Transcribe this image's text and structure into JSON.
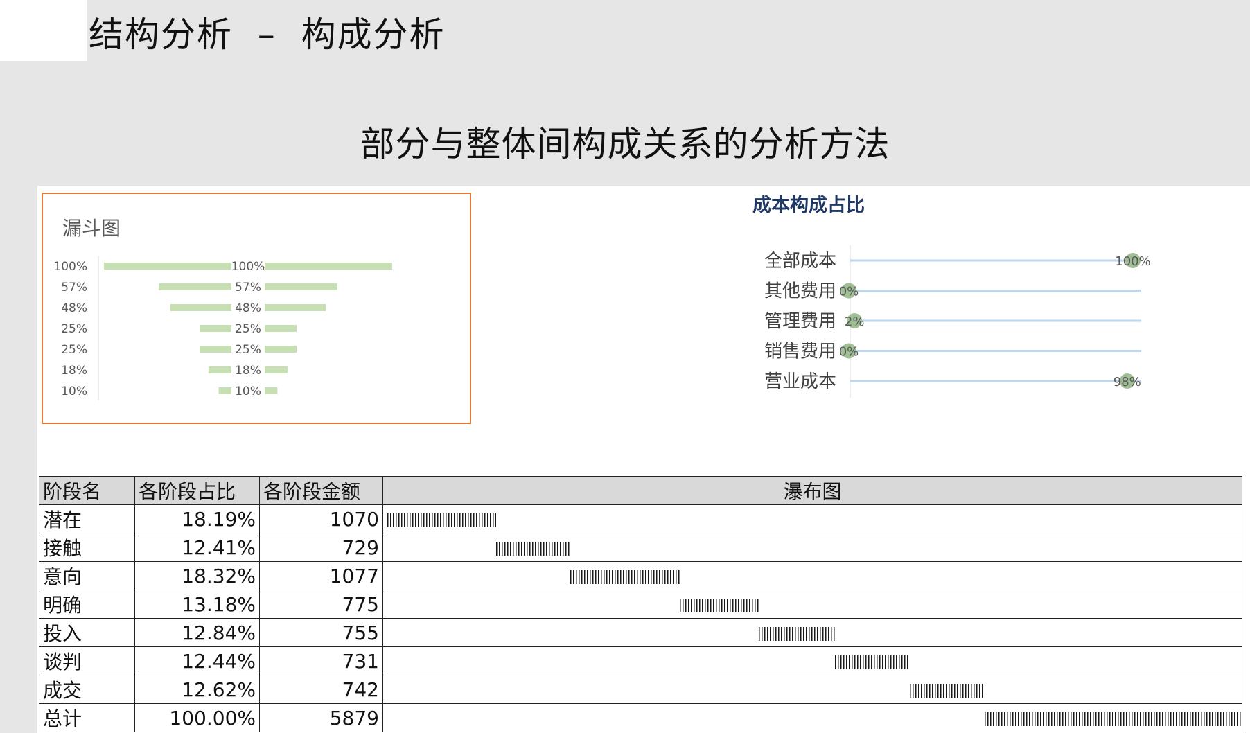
{
  "header": {
    "slide_title": "结构分析  –  构成分析",
    "subtitle": "部分与整体间构成关系的分析方法"
  },
  "colors": {
    "funnel_bar": "#c6e0b4",
    "card_border": "#e07b39",
    "lollipop_line": "#bdd7ee",
    "lollipop_dot": "#8fb381",
    "cost_title": "#1f3864"
  },
  "chart_data": [
    {
      "type": "bar",
      "subtype": "funnel",
      "title": "漏斗图",
      "categories": [
        "100%",
        "57%",
        "48%",
        "25%",
        "25%",
        "18%",
        "10%"
      ],
      "values": [
        100,
        57,
        48,
        25,
        25,
        18,
        10
      ],
      "data_labels": [
        "100%",
        "57%",
        "48%",
        "25%",
        "25%",
        "18%",
        "10%"
      ],
      "xlim": [
        0,
        100
      ],
      "grid": false
    },
    {
      "type": "scatter",
      "subtype": "lollipop",
      "title": "成本构成占比",
      "categories": [
        "全部成本",
        "其他费用",
        "管理费用",
        "销售费用",
        "营业成本"
      ],
      "values": [
        100,
        0,
        2,
        0,
        98
      ],
      "data_labels": [
        "100%",
        "0%",
        "2%",
        "0%",
        "98%"
      ],
      "xlim": [
        0,
        100
      ],
      "grid": false
    },
    {
      "type": "table",
      "subtype": "waterfall",
      "columns": [
        "阶段名",
        "各阶段占比",
        "各阶段金额",
        "瀑布图"
      ],
      "rows": [
        {
          "stage": "潜在",
          "share": "18.19%",
          "amount": "1070",
          "value": 1070
        },
        {
          "stage": "接触",
          "share": "12.41%",
          "amount": "729",
          "value": 729
        },
        {
          "stage": "意向",
          "share": "18.32%",
          "amount": "1077",
          "value": 1077
        },
        {
          "stage": "明确",
          "share": "13.18%",
          "amount": "775",
          "value": 775
        },
        {
          "stage": "投入",
          "share": "12.84%",
          "amount": "755",
          "value": 755
        },
        {
          "stage": "谈判",
          "share": "12.44%",
          "amount": "731",
          "value": 731
        },
        {
          "stage": "成交",
          "share": "12.62%",
          "amount": "742",
          "value": 742
        },
        {
          "stage": "总计",
          "share": "100.00%",
          "amount": "5879",
          "value": 5879,
          "is_total": true
        }
      ]
    }
  ]
}
